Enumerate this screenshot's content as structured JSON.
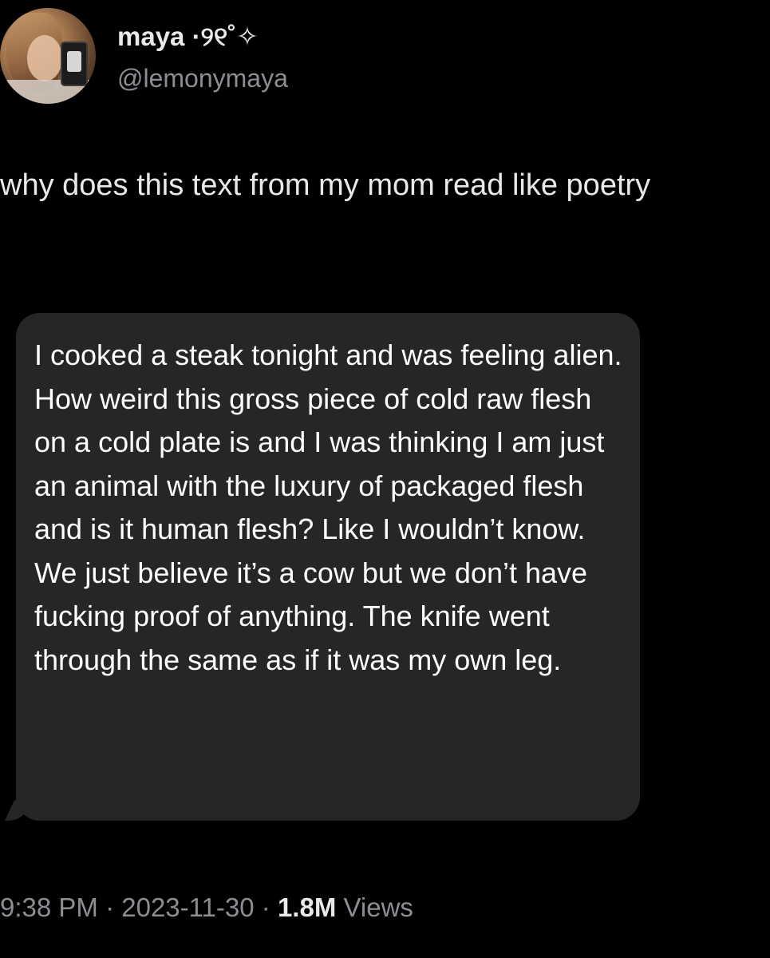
{
  "author": {
    "display_name": "maya ·୨୧˚✧",
    "handle": "@lemonymaya",
    "avatar_icon": "profile-photo-avatar"
  },
  "tweet": {
    "text": "why does this text from my mom read like poetry"
  },
  "message": {
    "bubble_color": "#262628",
    "text": "I cooked a steak tonight and was feeling alien. How weird this gross piece of cold raw flesh on a cold plate is and I was thinking I am just an animal with the luxury of packaged flesh and is it human flesh? Like I wouldn’t know. We just believe it’s a cow but we don’t have fucking proof of anything. The knife went through the same as if it was my own leg."
  },
  "meta": {
    "time": "9:38 PM",
    "separator": "·",
    "date": "2023-11-30",
    "views_count": "1.8M",
    "views_label": "Views"
  }
}
